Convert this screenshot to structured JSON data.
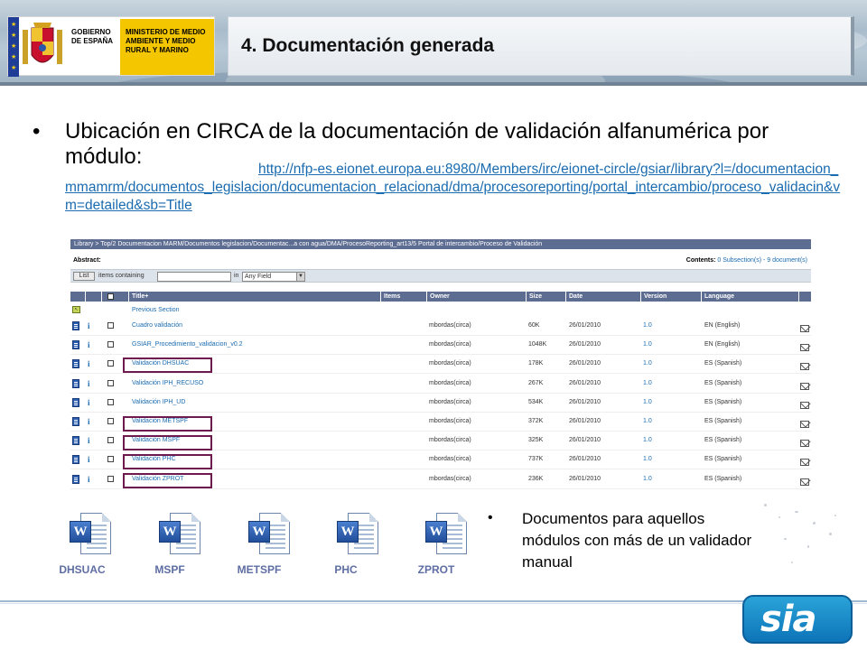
{
  "header": {
    "logo_gobierno": "GOBIERNO DE ESPAÑA",
    "logo_ministerio": "MINISTERIO DE MEDIO AMBIENTE Y MEDIO RURAL Y MARINO",
    "slide_title": "4. Documentación  generada"
  },
  "main": {
    "bullet": "•",
    "text": "Ubicación en CIRCA de la documentación de validación alfanumérica por módulo: ",
    "link": "http://nfp-es.eionet.europa.eu:8980/Members/irc/eionet-circle/gsiar/library?l=/documentacion_mmamrm/documentos_legislacion/documentacion_relacionad/dma/procesoreporting/portal_intercambio/proceso_validacin&vm=detailed&sb=Title"
  },
  "library": {
    "breadcrumb": "Library > Top/2 Documentacion MARM/Documentos legislacion/Documentac...a con agua/DMA/ProcesoReporting_art13/5 Portal de intercambio/Proceso de Validación",
    "abstract_label": "Abstract:",
    "contents_label": "Contents:",
    "contents_value": "0 Subsection(s) - 9 document(s)",
    "list_button": "List",
    "items_containing_label": "items containing",
    "in_label": "in",
    "in_select_value": "Any Field",
    "columns": [
      "Title+",
      "Items",
      "Owner",
      "Size",
      "Date",
      "Version",
      "Language"
    ],
    "previous_section": "Previous Section",
    "rows": [
      {
        "title": "Cuadro validación",
        "owner": "mbordas(circa)",
        "size": "60K",
        "date": "26/01/2010",
        "version": "1.0",
        "language": "EN (English)"
      },
      {
        "title": "GSIAR_Procedimiento_validacion_v0.2",
        "owner": "mbordas(circa)",
        "size": "1048K",
        "date": "26/01/2010",
        "version": "1.0",
        "language": "EN (English)"
      },
      {
        "title": "Validación DHSUAC",
        "owner": "mbordas(circa)",
        "size": "178K",
        "date": "26/01/2010",
        "version": "1.0",
        "language": "ES (Spanish)"
      },
      {
        "title": "Validación IPH_RECUSO",
        "owner": "mbordas(circa)",
        "size": "267K",
        "date": "26/01/2010",
        "version": "1.0",
        "language": "ES (Spanish)"
      },
      {
        "title": "Validación IPH_UD",
        "owner": "mbordas(circa)",
        "size": "534K",
        "date": "26/01/2010",
        "version": "1.0",
        "language": "ES (Spanish)"
      },
      {
        "title": "Validación METSPF",
        "owner": "mbordas(circa)",
        "size": "372K",
        "date": "26/01/2010",
        "version": "1.0",
        "language": "ES (Spanish)"
      },
      {
        "title": "Validación MSPF",
        "owner": "mbordas(circa)",
        "size": "325K",
        "date": "26/01/2010",
        "version": "1.0",
        "language": "ES (Spanish)"
      },
      {
        "title": "Validación PHC",
        "owner": "mbordas(circa)",
        "size": "737K",
        "date": "26/01/2010",
        "version": "1.0",
        "language": "ES (Spanish)"
      },
      {
        "title": "Validación ZPROT",
        "owner": "mbordas(circa)",
        "size": "236K",
        "date": "26/01/2010",
        "version": "1.0",
        "language": "ES (Spanish)"
      }
    ]
  },
  "docs": [
    {
      "label": "DHSUAC",
      "icon": "word-document-icon"
    },
    {
      "label": "MSPF",
      "icon": "word-document-icon"
    },
    {
      "label": "METSPF",
      "icon": "word-document-icon"
    },
    {
      "label": "PHC",
      "icon": "word-document-icon"
    },
    {
      "label": "ZPROT",
      "icon": "word-document-icon"
    }
  ],
  "note": {
    "bullet": "•",
    "text": "Documentos para aquellos módulos con más de un validador manual"
  },
  "footer": {
    "logo_text": "sia"
  },
  "colors": {
    "accent_blue": "#5d6c91",
    "link_blue": "#1a6bb0",
    "highlight": "#6e1a4e",
    "doc_label": "#5e6ea3"
  }
}
